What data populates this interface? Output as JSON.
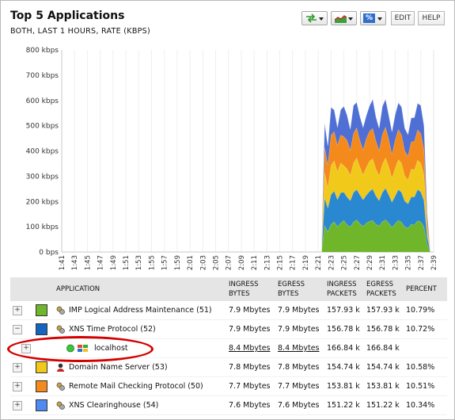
{
  "header": {
    "title": "Top 5 Applications",
    "subtitle": "BOTH, LAST 1 HOURS, RATE (KBPS)"
  },
  "toolbar": {
    "swap_icon": "swap-arrows-icon",
    "chart_icon": "area-chart-icon",
    "percent_label": "%",
    "edit_label": "EDIT",
    "help_label": "HELP"
  },
  "chart_data": {
    "type": "area",
    "stacked": true,
    "ylabel": "",
    "xlabel": "",
    "ylim": [
      0,
      800
    ],
    "y_ticks": [
      "0 bps",
      "100 kbps",
      "200 kbps",
      "300 kbps",
      "400 kbps",
      "500 kbps",
      "600 kbps",
      "700 kbps",
      "800 kbps"
    ],
    "x_ticks": [
      "1:41",
      "1:43",
      "1:45",
      "1:47",
      "1:49",
      "1:51",
      "1:53",
      "1:55",
      "1:57",
      "1:59",
      "2:01",
      "2:03",
      "2:05",
      "2:07",
      "2:09",
      "2:11",
      "2:13",
      "2:15",
      "2:17",
      "2:19",
      "2:21",
      "2:23",
      "2:25",
      "2:27",
      "2:29",
      "2:31",
      "2:33",
      "2:35",
      "2:37",
      "2:39"
    ],
    "x": [
      "2:21:30",
      "2:22",
      "2:22:30",
      "2:23",
      "2:23:30",
      "2:24",
      "2:24:30",
      "2:25",
      "2:25:30",
      "2:26",
      "2:26:30",
      "2:27",
      "2:27:30",
      "2:28",
      "2:28:30",
      "2:29",
      "2:29:30",
      "2:30",
      "2:30:30",
      "2:31",
      "2:31:30",
      "2:32",
      "2:32:30",
      "2:33",
      "2:33:30",
      "2:34",
      "2:34:30",
      "2:35",
      "2:35:30",
      "2:36",
      "2:36:30",
      "2:37",
      "2:37:30",
      "2:38",
      "2:38:30"
    ],
    "series": [
      {
        "name": "IMP Logical Address Maintenance",
        "color": "#6fb62a",
        "values": [
          0,
          105,
          80,
          110,
          120,
          100,
          115,
          125,
          108,
          100,
          118,
          128,
          112,
          102,
          115,
          122,
          125,
          110,
          104,
          120,
          128,
          115,
          98,
          112,
          126,
          118,
          100,
          95,
          110,
          108,
          124,
          120,
          100,
          30,
          0
        ]
      },
      {
        "name": "XNS Time Protocol",
        "color": "#2a88d0",
        "values": [
          0,
          110,
          95,
          118,
          122,
          108,
          120,
          112,
          110,
          104,
          118,
          120,
          115,
          105,
          110,
          118,
          125,
          112,
          100,
          116,
          125,
          112,
          100,
          110,
          122,
          118,
          102,
          96,
          108,
          110,
          124,
          118,
          104,
          30,
          0
        ]
      },
      {
        "name": "Domain Name Server",
        "color": "#f0c91a",
        "values": [
          0,
          100,
          80,
          115,
          120,
          110,
          118,
          105,
          112,
          100,
          116,
          125,
          110,
          98,
          110,
          120,
          120,
          108,
          98,
          112,
          120,
          112,
          95,
          110,
          118,
          116,
          100,
          95,
          110,
          108,
          116,
          114,
          100,
          30,
          0
        ]
      },
      {
        "name": "Remote Mail Checking Protocol",
        "color": "#f48a1c",
        "values": [
          0,
          100,
          90,
          120,
          115,
          105,
          110,
          115,
          112,
          100,
          118,
          120,
          105,
          100,
          115,
          118,
          120,
          110,
          100,
          118,
          122,
          108,
          95,
          112,
          120,
          112,
          98,
          94,
          108,
          112,
          120,
          118,
          102,
          30,
          0
        ]
      },
      {
        "name": "XNS Clearinghouse",
        "color": "#4f6fd4",
        "values": [
          0,
          95,
          75,
          110,
          85,
          70,
          100,
          120,
          100,
          82,
          110,
          100,
          95,
          88,
          90,
          100,
          115,
          95,
          88,
          110,
          110,
          95,
          88,
          100,
          105,
          110,
          90,
          85,
          95,
          94,
          105,
          110,
          94,
          30,
          0
        ]
      }
    ],
    "grid": "vertical"
  },
  "table": {
    "headers": [
      {
        "key": "application",
        "label": "APPLICATION"
      },
      {
        "key": "ingress_bytes",
        "label": "INGRESS BYTES"
      },
      {
        "key": "egress_bytes",
        "label": "EGRESS BYTES"
      },
      {
        "key": "ingress_packets",
        "label": "INGRESS PACKETS"
      },
      {
        "key": "egress_packets",
        "label": "EGRESS PACKETS"
      },
      {
        "key": "percent",
        "label": "PERCENT"
      }
    ],
    "rows": [
      {
        "expand": "+",
        "color": "#6fb62a",
        "icon": "app-gear-icon",
        "name": "IMP Logical Address Maintenance (51)",
        "ingress_bytes": "7.9 Mbytes",
        "egress_bytes": "7.9 Mbytes",
        "ingress_packets": "157.93 k",
        "egress_packets": "157.93 k",
        "percent": "10.79%"
      },
      {
        "expand": "−",
        "color": "#1565c0",
        "icon": "app-gear-icon",
        "name": "XNS Time Protocol (52)",
        "ingress_bytes": "7.9 Mbytes",
        "egress_bytes": "7.9 Mbytes",
        "ingress_packets": "156.78 k",
        "egress_packets": "156.78 k",
        "percent": "10.72%"
      },
      {
        "expand": "+",
        "color": "",
        "icon": "windows-host-icon",
        "name": "localhost",
        "ingress_bytes": "8.4 Mbytes",
        "egress_bytes": "8.4 Mbytes",
        "ingress_packets": "166.84 k",
        "egress_packets": "166.84 k",
        "percent": "",
        "child": true
      },
      {
        "expand": "+",
        "color": "#f0c91a",
        "icon": "dns-person-icon",
        "name": "Domain Name Server (53)",
        "ingress_bytes": "7.8 Mbytes",
        "egress_bytes": "7.8 Mbytes",
        "ingress_packets": "154.74 k",
        "egress_packets": "154.74 k",
        "percent": "10.58%"
      },
      {
        "expand": "+",
        "color": "#f48a1c",
        "icon": "app-gear-icon",
        "name": "Remote Mail Checking Protocol (50)",
        "ingress_bytes": "7.7 Mbytes",
        "egress_bytes": "7.7 Mbytes",
        "ingress_packets": "153.81 k",
        "egress_packets": "153.81 k",
        "percent": "10.51%"
      },
      {
        "expand": "+",
        "color": "#4f8af0",
        "icon": "app-gear-icon",
        "name": "XNS Clearinghouse (54)",
        "ingress_bytes": "7.6 Mbytes",
        "egress_bytes": "7.6 Mbytes",
        "ingress_packets": "151.22 k",
        "egress_packets": "151.22 k",
        "percent": "10.34%"
      }
    ]
  }
}
